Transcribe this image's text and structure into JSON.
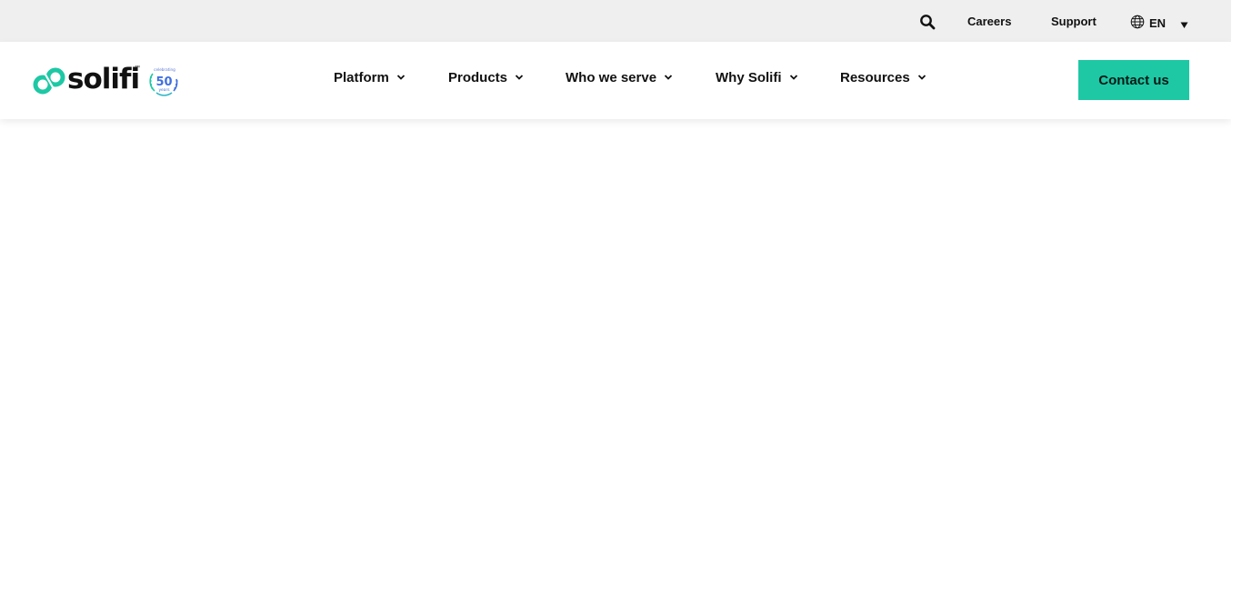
{
  "utility_bar": {
    "links": [
      "Careers",
      "Support"
    ],
    "language": "EN"
  },
  "header": {
    "logo": {
      "wordmark": "solifi",
      "trademark": "™",
      "badge": {
        "number": "50",
        "top_text": "celebrating",
        "bottom_text": "years"
      }
    },
    "nav": [
      {
        "label": "Platform"
      },
      {
        "label": "Products"
      },
      {
        "label": "Who we serve"
      },
      {
        "label": "Why Solifi"
      },
      {
        "label": "Resources"
      }
    ],
    "cta_label": "Contact us"
  },
  "colors": {
    "brand_teal": "#1ec8a5",
    "utility_bg": "#efefef",
    "text": "#111111",
    "badge_blue": "#3f6fe0"
  },
  "icons": [
    "search-icon",
    "globe-icon",
    "caret-down-icon",
    "chevron-down-icon",
    "solifi-logo-mark",
    "anniversary-badge"
  ]
}
